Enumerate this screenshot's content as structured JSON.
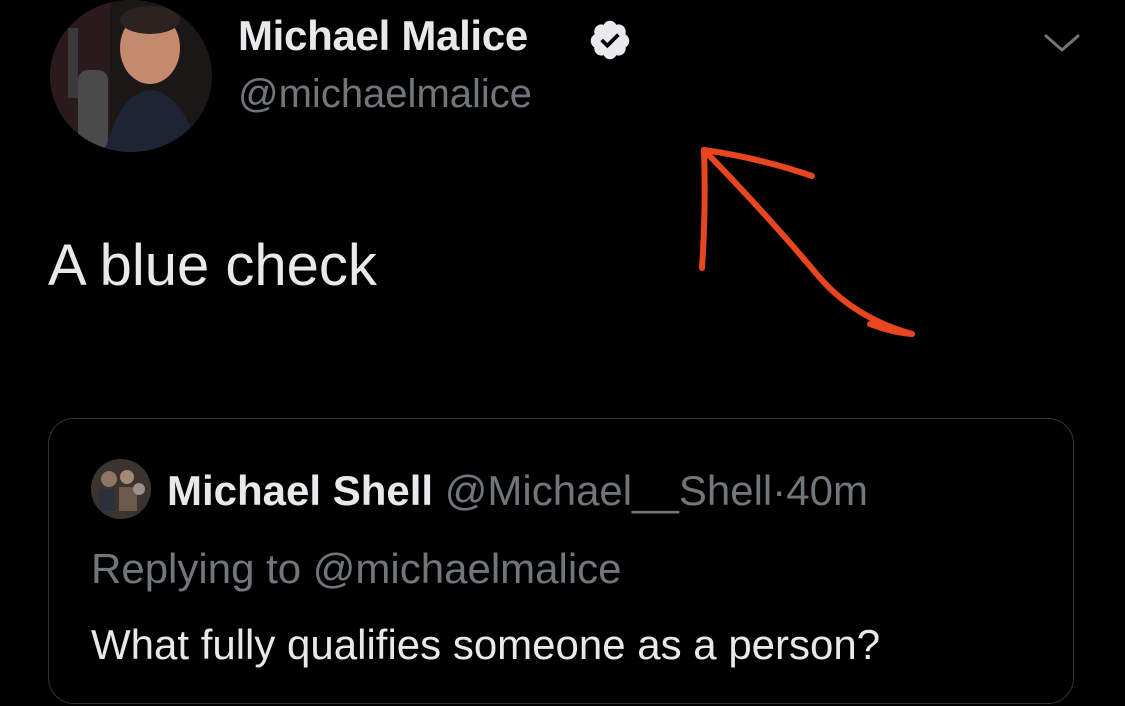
{
  "tweet": {
    "author": {
      "display_name": "Michael Malice",
      "handle": "@michaelmalice",
      "verified_icon": "verified-badge-icon",
      "avatar": "profile-photo"
    },
    "menu_icon": "chevron-down-icon",
    "text": "A blue check",
    "annotation": {
      "type": "hand-drawn-arrow",
      "color": "#e8461e"
    }
  },
  "quote": {
    "author": {
      "display_name": "Michael Shell",
      "handle": "@Michael__Shell",
      "separator": "·",
      "time": "40m",
      "avatar": "profile-photo"
    },
    "replying_to": "Replying to @michaelmalice",
    "text": "What fully qualifies someone as a person?"
  },
  "colors": {
    "background": "#000000",
    "primary_text": "#e7e9ea",
    "secondary_text": "#71767b",
    "border": "#2f3336",
    "arrow": "#e8461e"
  }
}
